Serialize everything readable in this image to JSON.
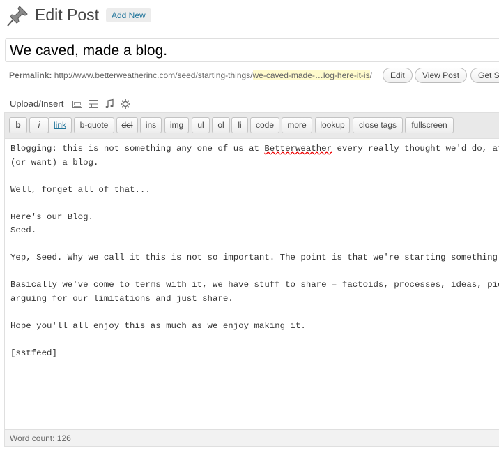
{
  "header": {
    "title": "Edit Post",
    "add_new_label": "Add New",
    "icon": "pushpin-icon"
  },
  "post": {
    "title": "We caved, made a blog."
  },
  "permalink": {
    "label": "Permalink:",
    "base_url": "http://www.betterweatherinc.com/seed/starting-things/",
    "slug": "we-caved-made-…log-here-it-is",
    "trailing": "/",
    "edit_label": "Edit",
    "view_label": "View Post",
    "shortlink_label": "Get Sh"
  },
  "upload": {
    "label": "Upload/Insert",
    "icons": [
      "image-icon",
      "video-icon",
      "audio-icon",
      "media-icon"
    ]
  },
  "quicktags": [
    "b",
    "i",
    "link",
    "b-quote",
    "del",
    "ins",
    "img",
    "ul",
    "ol",
    "li",
    "code",
    "more",
    "lookup",
    "close tags",
    "fullscreen"
  ],
  "content": {
    "line1_before": "Blogging: this is not something any one of us at ",
    "line1_misspelled": "Betterweather",
    "line1_after": " every really thought we'd do, at least",
    "line2": "(or want) a blog.",
    "line3": "Well, forget all of that...",
    "line4": "Here's our Blog.",
    "line5": "Seed.",
    "line6": "Yep, Seed. Why we call it this is not so important. The point is that we're starting something. Poking",
    "line7": "Basically we've come to terms with it, we have stuff to share – factoids, processes, ideas, pictures, ",
    "line8": "arguing for our limitations and just share.",
    "line9": "Hope you'll all enjoy this as much as we enjoy making it.",
    "line10": "[sstfeed]"
  },
  "status": {
    "word_count": "Word count: 126"
  }
}
